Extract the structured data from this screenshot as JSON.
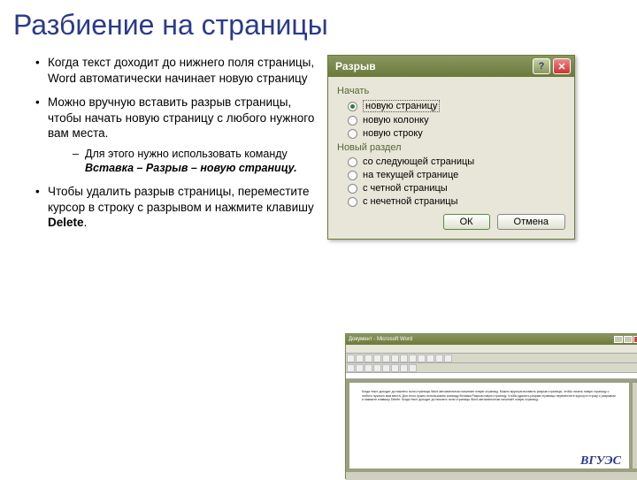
{
  "slide": {
    "title": "Разбиение на страницы",
    "bullet1": "Когда текст доходит до нижнего поля страницы, Word автоматически начинает новую страницу",
    "bullet2": "Можно вручную вставить разрыв страницы, чтобы начать новую страницу с любого нужного вам места.",
    "sub_bullet_prefix": "Для этого нужно использовать команду ",
    "sub_bullet_emph": "Вставка – Разрыв – новую страницу.",
    "bullet3_a": "Чтобы удалить разрыв страницы, переместите курсор в строку с разрывом и нажмите клавишу ",
    "bullet3_b": "Delete",
    "bullet3_c": "."
  },
  "dialog": {
    "title": "Разрыв",
    "help": "?",
    "close": "✕",
    "section1": "Начать",
    "opt1": "новую страницу",
    "opt2": "новую колонку",
    "opt3": "новую строку",
    "section2": "Новый раздел",
    "opt4": "со следующей страницы",
    "opt5": "на текущей странице",
    "opt6": "с четной страницы",
    "opt7": "с нечетной страницы",
    "ok": "ОК",
    "cancel": "Отмена"
  },
  "word": {
    "title": "Документ - Microsoft Word",
    "doc_text": "Когда текст доходит до нижнего поля страницы Word автоматически начинает новую страницу. Можно вручную вставить разрыв страницы, чтобы начать новую страницу с любого нужного вам места. Для этого нужно использовать команду Вставка Разрыв новую страницу. Чтобы удалить разрыв страницы переместите курсор в строку с разрывом и нажмите клавишу Delete. Когда текст доходит до нижнего поля страницы Word автоматически начинает новую страницу."
  },
  "footer": {
    "logo": "ВГУЭС"
  }
}
